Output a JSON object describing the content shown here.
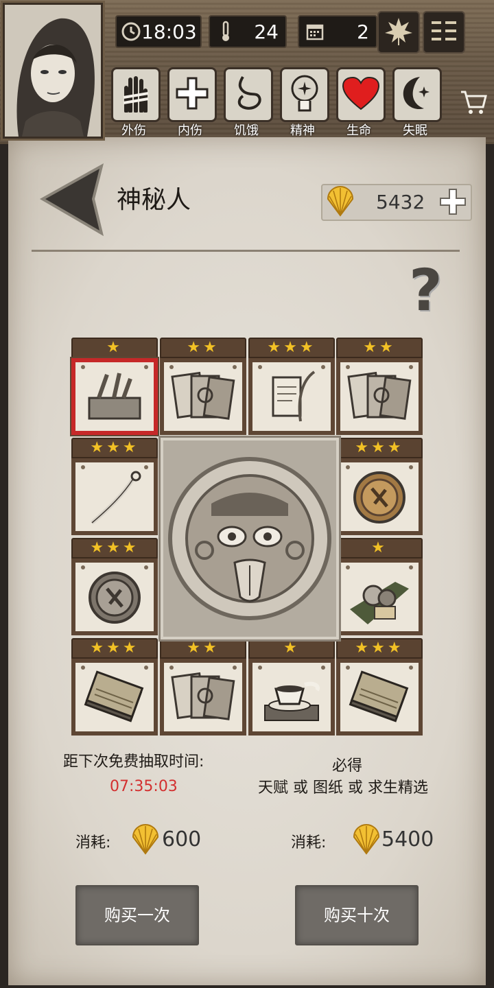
{
  "header": {
    "time": "18:03",
    "temperature": "24",
    "day": "2",
    "status_labels": [
      "外伤",
      "内伤",
      "饥饿",
      "精神",
      "生命",
      "失眠"
    ]
  },
  "page": {
    "title": "神秘人",
    "shells": "5432"
  },
  "grid": {
    "cards": [
      {
        "stars": "★",
        "item": "toolbox-icon",
        "selected": true
      },
      {
        "stars": "★★",
        "item": "cards-icon"
      },
      {
        "stars": "★★★",
        "item": "scroll-quill-icon"
      },
      {
        "stars": "★★",
        "item": "cards-icon"
      },
      {
        "stars": "★★★",
        "item": "cutlass-icon"
      },
      {
        "stars": "★★★",
        "item": "gold-coin-icon"
      },
      {
        "stars": "★★★",
        "item": "silver-coin-icon"
      },
      {
        "stars": "★",
        "item": "food-icon"
      },
      {
        "stars": "★★★",
        "item": "blueprint-icon"
      },
      {
        "stars": "★★",
        "item": "cards-icon"
      },
      {
        "stars": "★",
        "item": "teacup-icon"
      },
      {
        "stars": "★★★",
        "item": "blueprint-icon"
      }
    ]
  },
  "draw": {
    "free_label": "距下次免费抽取时间:",
    "timer": "07:35:03",
    "guarantee_title": "必得",
    "guarantee_desc": "天赋 或 图纸 或 求生精选",
    "cost_label": "消耗:",
    "single_cost": "600",
    "ten_cost": "5400",
    "buy_one": "购买一次",
    "buy_ten": "购买十次"
  }
}
